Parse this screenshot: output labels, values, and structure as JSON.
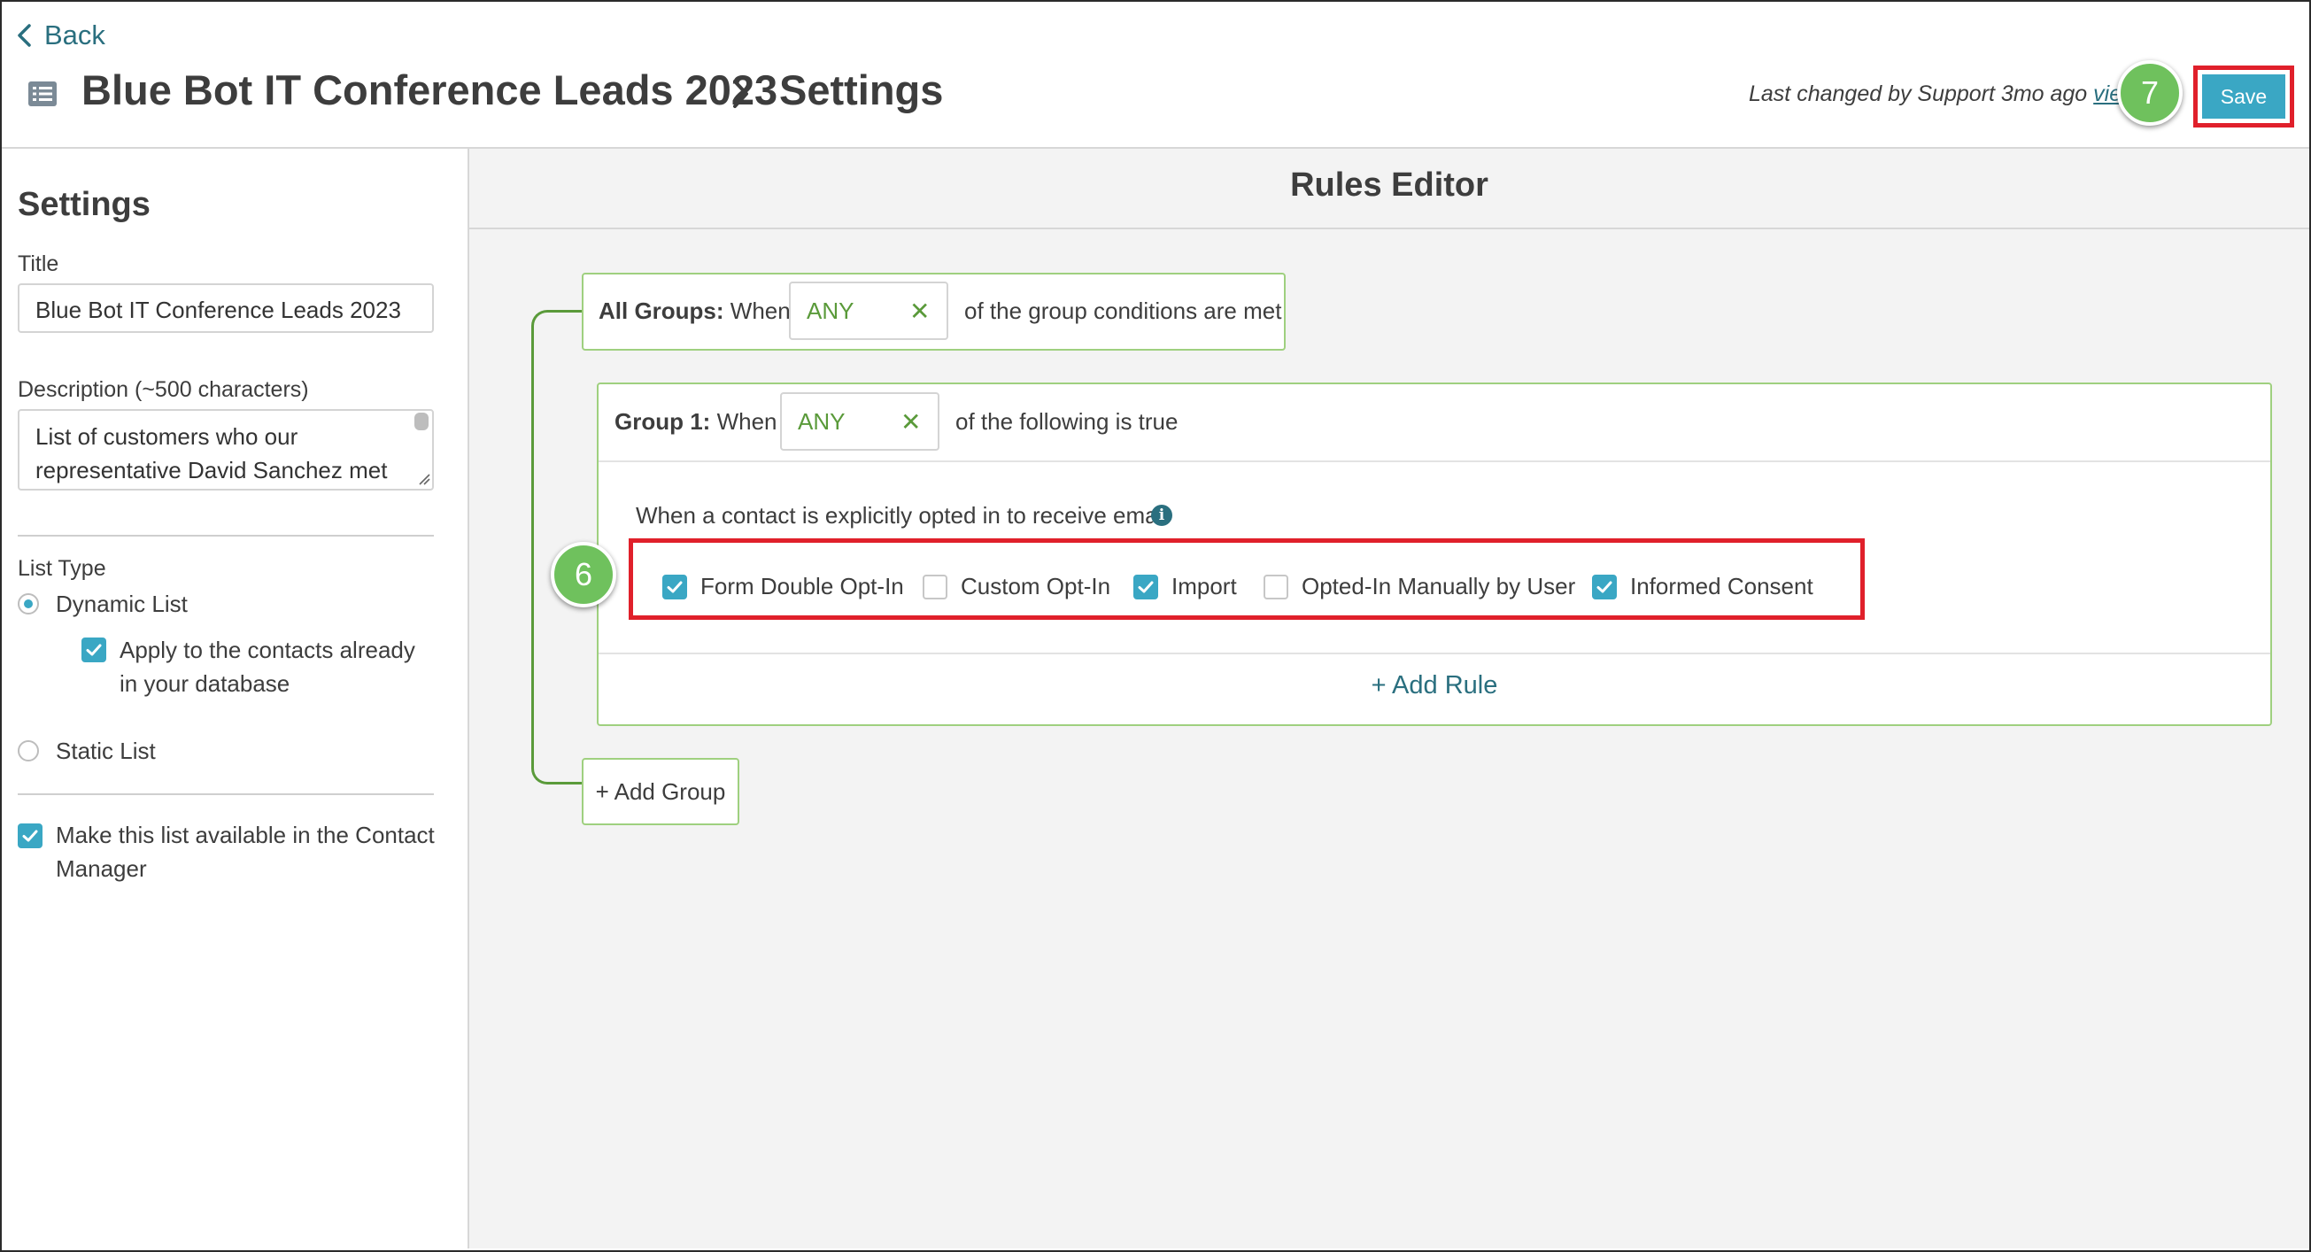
{
  "header": {
    "back_label": "Back",
    "list_name": "Blue Bot IT Conference Leads 2023",
    "current_page": "Settings",
    "last_changed_prefix": "Last changed by Support 3mo ago ",
    "view_history_label": "view h",
    "save_label": "Save",
    "markers": {
      "save_step": "7",
      "optin_step": "6"
    }
  },
  "sidebar": {
    "heading": "Settings",
    "title_label": "Title",
    "title_value": "Blue Bot IT Conference Leads 2023",
    "description_label": "Description (~500 characters)",
    "description_line1": "List of customers who our",
    "description_line2": "representative David Sanchez met",
    "list_type_label": "List Type",
    "dynamic_list_label": "Dynamic List",
    "dynamic_selected": true,
    "apply_existing_line1": "Apply to the contacts already",
    "apply_existing_line2": "in your database",
    "apply_existing_checked": true,
    "static_list_label": "Static List",
    "contact_manager_line1": "Make this list available in the Contact",
    "contact_manager_line2": "Manager",
    "contact_manager_checked": true
  },
  "rules_editor": {
    "title": "Rules Editor",
    "all_groups": {
      "label_bold": "All Groups:",
      "label_when": " When",
      "match_value": "ANY",
      "suffix": "of the group conditions are met"
    },
    "group1": {
      "label_bold": "Group 1:",
      "label_when": " When",
      "match_value": "ANY",
      "suffix": "of the following is true",
      "rule_text": "When a contact is explicitly opted in to receive email",
      "info_glyph": "i",
      "options": [
        {
          "label": "Form Double Opt-In",
          "checked": true
        },
        {
          "label": "Custom Opt-In",
          "checked": false
        },
        {
          "label": "Import",
          "checked": true
        },
        {
          "label": "Opted-In Manually by User",
          "checked": false
        },
        {
          "label": "Informed Consent",
          "checked": true
        }
      ]
    },
    "add_rule_label": "+ Add Rule",
    "add_group_label": "+ Add Group",
    "clear_glyph": "✕"
  },
  "colors": {
    "accent_teal": "#3aa7c4",
    "link_teal": "#2a6f7f",
    "group_green": "#5a9a3a",
    "highlight_red": "#e0202b",
    "marker_green": "#6fc15d"
  }
}
